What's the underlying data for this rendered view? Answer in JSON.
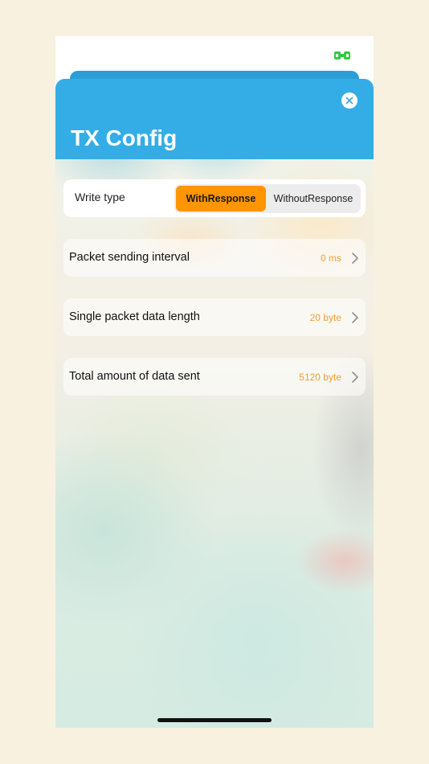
{
  "colors": {
    "header_blue": "#34ade6",
    "accent_orange": "#ff9500",
    "value_orange": "#f0a030",
    "background": "#f8f1e0"
  },
  "status_bar": {
    "icon": "battery-icon",
    "icon_color": "#2ecc40"
  },
  "sheet": {
    "title": "TX Config",
    "close_icon": "close-icon"
  },
  "write_type": {
    "label": "Write type",
    "options": [
      "WithResponse",
      "WithoutResponse"
    ],
    "selected": "WithResponse"
  },
  "settings": [
    {
      "label": "Packet sending interval",
      "value": "0 ms"
    },
    {
      "label": "Single packet data length",
      "value": "20 byte"
    },
    {
      "label": "Total amount of data sent",
      "value": "5120 byte"
    }
  ]
}
